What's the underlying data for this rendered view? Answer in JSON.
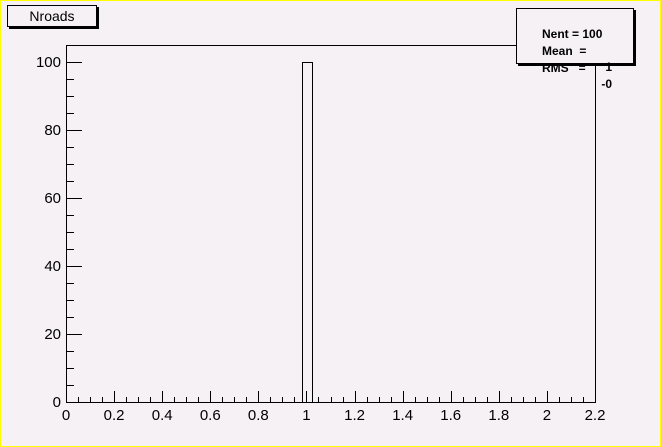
{
  "canvas": {
    "border_color": "#ffff00",
    "background_color": "#f5f1f5"
  },
  "title_box": {
    "text": "Nroads"
  },
  "stats": {
    "rows": [
      {
        "label": "Nent = 100",
        "value": ""
      },
      {
        "label": "Mean  =",
        "value": "1"
      },
      {
        "label": "RMS   =",
        "value": "-0"
      }
    ]
  },
  "chart_data": {
    "type": "bar",
    "title": "Nroads",
    "x_edges": [
      0.98,
      1.02
    ],
    "values": [
      100
    ],
    "xlim": [
      0,
      2.2
    ],
    "ylim": [
      0,
      105
    ],
    "x_ticks": [
      "0",
      "0.2",
      "0.4",
      "0.6",
      "0.8",
      "1",
      "1.2",
      "1.4",
      "1.6",
      "1.8",
      "2",
      "2.2"
    ],
    "y_ticks": [
      "0",
      "20",
      "40",
      "60",
      "80",
      "100"
    ],
    "grid": false
  }
}
